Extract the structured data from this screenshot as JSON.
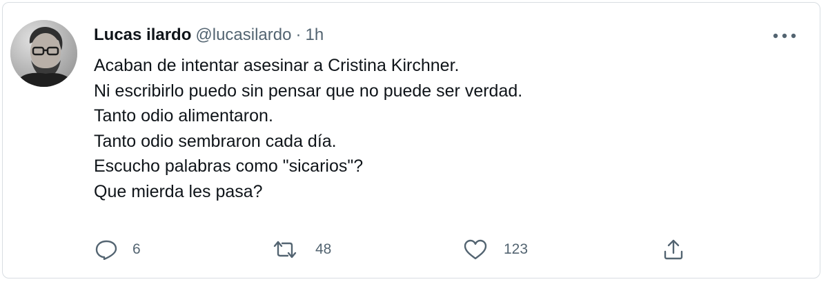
{
  "author": {
    "name": "Lucas ilardo",
    "handle": "@lucasilardo",
    "separator": "·",
    "time": "1h"
  },
  "tweet": {
    "lines": [
      "Acaban de intentar asesinar a Cristina Kirchner.",
      "Ni escribirlo puedo sin pensar que no puede ser verdad.",
      "Tanto odio alimentaron.",
      "Tanto odio sembraron cada día.",
      "Escucho palabras como \"sicarios\"?",
      "Que mierda les pasa?"
    ]
  },
  "actions": {
    "reply": {
      "icon": "reply-icon",
      "count": "6"
    },
    "retweet": {
      "icon": "retweet-icon",
      "count": "48"
    },
    "like": {
      "icon": "heart-icon",
      "count": "123"
    },
    "share": {
      "icon": "share-icon"
    }
  },
  "colors": {
    "text": "#0f1419",
    "secondary": "#536471",
    "border": "#d8dde2"
  }
}
